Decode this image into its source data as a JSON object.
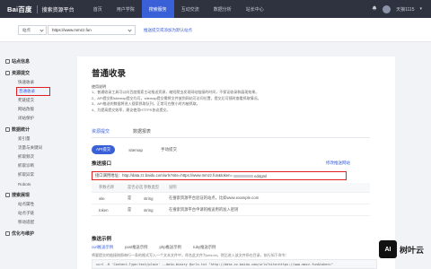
{
  "header": {
    "brand_logo": "Bai百度",
    "brand_product": "搜索资源平台",
    "nav": [
      "首页",
      "用户学院",
      "搜索服务",
      "互动交流",
      "数据分析",
      "站长中心"
    ],
    "active_nav_index": 2,
    "user_name": "天狼1115"
  },
  "site_bar": {
    "select_value": "站点",
    "site_value": "https://www.mmzz.fun",
    "link": "推送提交或添加为默认站点"
  },
  "sidebar": {
    "groups": [
      {
        "label": "站点信息",
        "items": []
      },
      {
        "label": "资源提交",
        "items": [
          "快速收录",
          "普通收录",
          "死链提交",
          "网站改版",
          "闭站保护"
        ]
      },
      {
        "label": "数据统计",
        "items": [
          "索引量",
          "流量与关键词",
          "抓取频次",
          "抓取诊断",
          "抓取异常",
          "Robots"
        ]
      },
      {
        "label": "搜索展现",
        "items": [
          "站点属性",
          "站点子链",
          "移动适配"
        ]
      },
      {
        "label": "优化与维护",
        "items": []
      }
    ],
    "active_item": "普通收录"
  },
  "main": {
    "title": "普通收录",
    "notes_head": "使用说明",
    "notes": [
      "1、普通收录工具可以向百度搜索主动推送资源，缩短爬虫发现网站链接的时间，不保证收录和展现效果。",
      "2、API提交和sitemap提交均可。sitemap提交需将文件放到网站可访问位置，提交后可随时查看抓取情况。",
      "3、API推送的数据将进入搜索抓取队列，正常可在数小时内被抓取。",
      "4、为提高提交效率，建议使用HTTPS协议提交。"
    ],
    "tabs": [
      "资源提交",
      "数据报表"
    ],
    "active_tab": 0,
    "subtabs": [
      "API提交",
      "sitemap",
      "手动提交"
    ],
    "active_subtab": 0,
    "api_title": "推送接口",
    "api_link": "修改推送网站",
    "api_url_prefix": "接口调用地址：http://data.zz.baidu.com/urls?site=https://www.mmzz.fun&token=",
    "api_url_suffix": "ed4gml",
    "param_headers": [
      "参数名称",
      "是否必选",
      "参数类型",
      "说明"
    ],
    "params": [
      {
        "name": "site",
        "required": "是",
        "type": "string",
        "desc": "在搜索资源平台验证的站点，比如www.example.com"
      },
      {
        "name": "token",
        "required": "是",
        "type": "string",
        "desc": "在搜索资源平台申请的推送用的准入密钥"
      }
    ],
    "sample_title": "推送示例",
    "sample_tabs": [
      "curl推送示例",
      "post推送示例",
      "php推送示例",
      "ruby推送示例"
    ],
    "active_sample": 0,
    "sample_desc": "将要提交的链接按照每行一条的格式写入一个文本文件中，命名此文件为urls.txt，然后进入该文件所在目录，执行如下命令：",
    "code": "curl -H 'Content-Type:text/plain' --data-binary @urls.txt \"http://data.zz.baidu.com/urls?site=https://www.mmzz.fun&token=\""
  },
  "watermark": {
    "badge": "AI",
    "text": "树叶云"
  }
}
